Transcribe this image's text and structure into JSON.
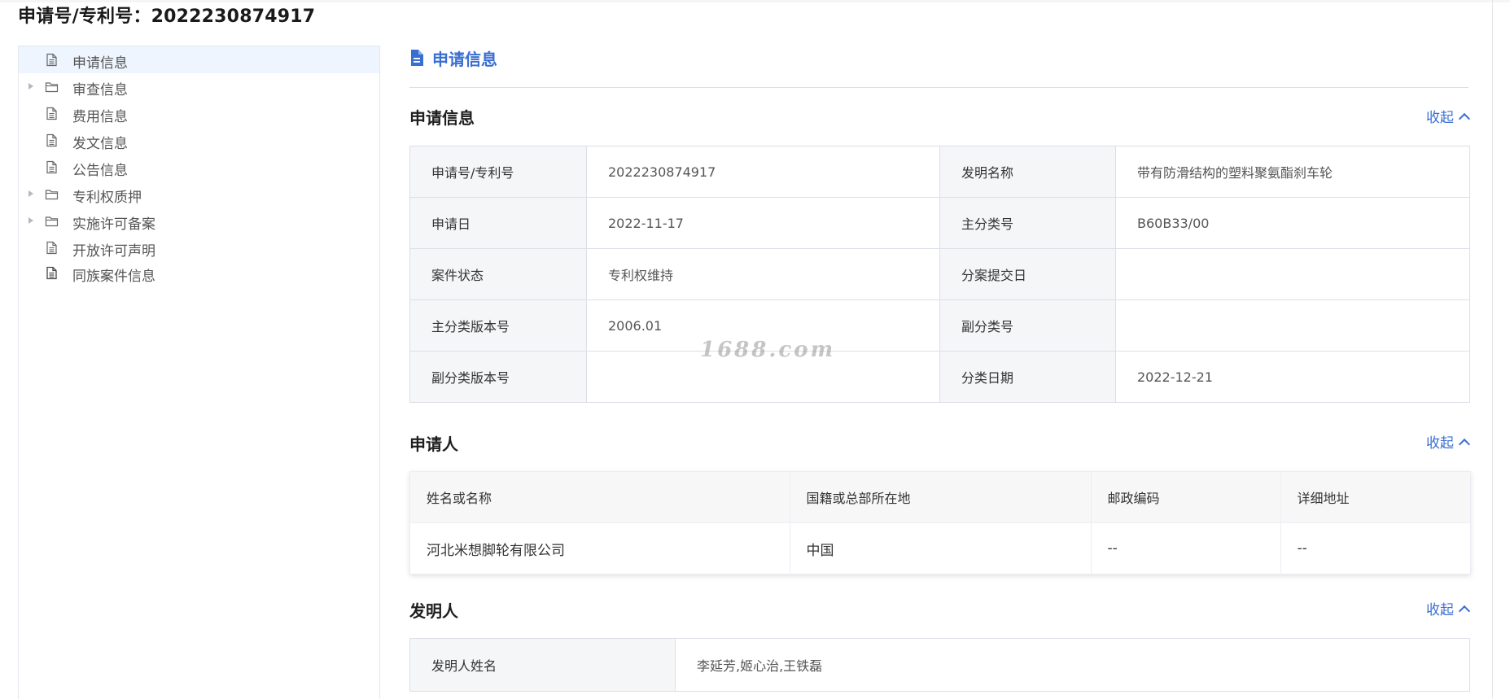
{
  "page": {
    "title": "申请号/专利号：2022230874917"
  },
  "sidebar": {
    "items": [
      {
        "label": "申请信息",
        "icon": "document-icon",
        "expandable": false,
        "active": true
      },
      {
        "label": "审查信息",
        "icon": "folder-icon",
        "expandable": true,
        "active": false
      },
      {
        "label": "费用信息",
        "icon": "document-icon",
        "expandable": false,
        "active": false
      },
      {
        "label": "发文信息",
        "icon": "document-icon",
        "expandable": false,
        "active": false
      },
      {
        "label": "公告信息",
        "icon": "document-icon",
        "expandable": false,
        "active": false
      },
      {
        "label": "专利权质押",
        "icon": "folder-icon",
        "expandable": true,
        "active": false
      },
      {
        "label": "实施许可备案",
        "icon": "folder-icon",
        "expandable": true,
        "active": false
      },
      {
        "label": "开放许可声明",
        "icon": "document-icon",
        "expandable": false,
        "active": false
      },
      {
        "label": "同族案件信息",
        "icon": "document-icon",
        "expandable": false,
        "active": false
      }
    ]
  },
  "main": {
    "header": {
      "label": "申请信息",
      "icon": "document-filled-icon"
    },
    "collapse_label": "收起",
    "application": {
      "title": "申请信息",
      "rows": [
        [
          "申请号/专利号",
          "2022230874917",
          "发明名称",
          "带有防滑结构的塑料聚氨酯刹车轮"
        ],
        [
          "申请日",
          "2022-11-17",
          "主分类号",
          "B60B33/00"
        ],
        [
          "案件状态",
          "专利权维持",
          "分案提交日",
          ""
        ],
        [
          "主分类版本号",
          "2006.01",
          "副分类号",
          ""
        ],
        [
          "副分类版本号",
          "",
          "分类日期",
          "2022-12-21"
        ]
      ]
    },
    "applicant": {
      "title": "申请人",
      "headers": [
        "姓名或名称",
        "国籍或总部所在地",
        "邮政编码",
        "详细地址"
      ],
      "rows": [
        [
          "河北米想脚轮有限公司",
          "中国",
          "--",
          "--"
        ]
      ]
    },
    "inventor": {
      "title": "发明人",
      "label": "发明人姓名",
      "value": "李延芳,姬心治,王铁磊"
    }
  },
  "watermark": "1688.com",
  "colors": {
    "accent": "#3a6fd2",
    "active_bg": "#eef5fe",
    "label_bg": "#f5f6f8",
    "border": "#dcdfe6"
  }
}
